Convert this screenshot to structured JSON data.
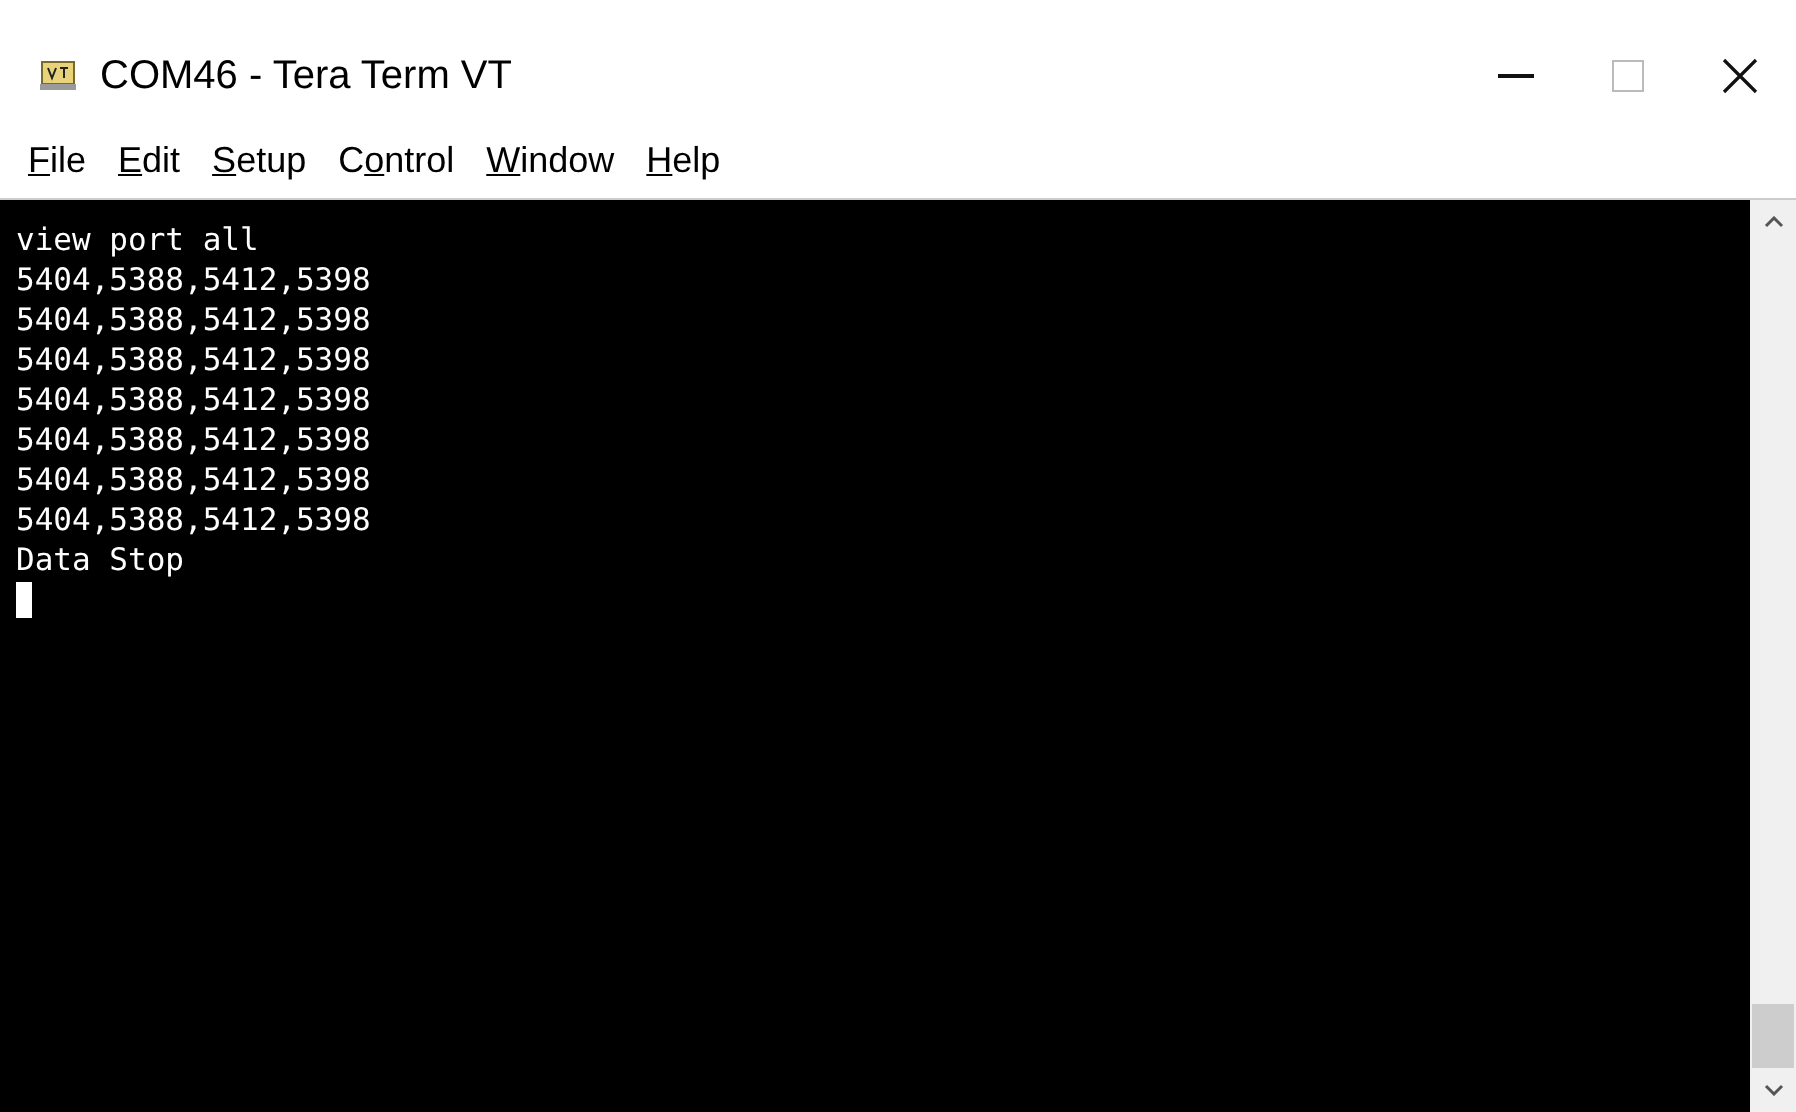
{
  "window": {
    "title": "COM46 - Tera Term VT"
  },
  "menu": [
    {
      "key": "F",
      "after": "ile"
    },
    {
      "key": "E",
      "after": "dit"
    },
    {
      "key": "S",
      "after": "etup"
    },
    {
      "before": "C",
      "key": "o",
      "after": "ntrol"
    },
    {
      "key": "W",
      "after": "indow"
    },
    {
      "key": "H",
      "after": "elp"
    }
  ],
  "terminal": {
    "lines": [
      "view port all",
      "5404,5388,5412,5398",
      "5404,5388,5412,5398",
      "5404,5388,5412,5398",
      "5404,5388,5412,5398",
      "5404,5388,5412,5398",
      "5404,5388,5412,5398",
      "5404,5388,5412,5398",
      "Data Stop"
    ],
    "cursor": true
  }
}
